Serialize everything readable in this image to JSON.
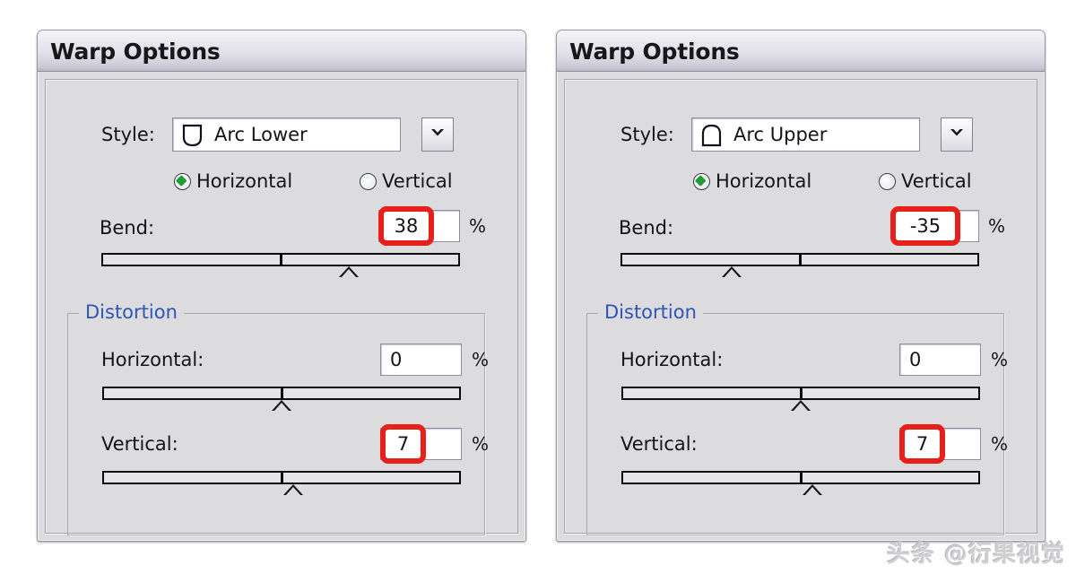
{
  "watermark": "头条 @衍果视觉",
  "panels": [
    {
      "title": "Warp Options",
      "style": {
        "label": "Style:",
        "value": "Arc Lower",
        "icon": "arc-lower-shape-icon",
        "dropdown_icon": "chevron-down-icon"
      },
      "orientation": {
        "horizontal": {
          "label": "Horizontal",
          "selected": true
        },
        "vertical": {
          "label": "Vertical",
          "selected": false
        }
      },
      "bend": {
        "label": "Bend:",
        "value": "38",
        "unit": "%",
        "highlighted": true,
        "thumb_pct": 69
      },
      "distortion": {
        "title": "Distortion",
        "horizontal": {
          "label": "Horizontal:",
          "value": "0",
          "unit": "%",
          "highlighted": false,
          "thumb_pct": 50
        },
        "vertical": {
          "label": "Vertical:",
          "value": "7",
          "unit": "%",
          "highlighted": true,
          "thumb_pct": 53
        }
      }
    },
    {
      "title": "Warp Options",
      "style": {
        "label": "Style:",
        "value": "Arc Upper",
        "icon": "arc-upper-shape-icon",
        "dropdown_icon": "chevron-down-icon"
      },
      "orientation": {
        "horizontal": {
          "label": "Horizontal",
          "selected": true
        },
        "vertical": {
          "label": "Vertical",
          "selected": false
        }
      },
      "bend": {
        "label": "Bend:",
        "value": "-35",
        "unit": "%",
        "highlighted": true,
        "thumb_pct": 31
      },
      "distortion": {
        "title": "Distortion",
        "horizontal": {
          "label": "Horizontal:",
          "value": "0",
          "unit": "%",
          "highlighted": false,
          "thumb_pct": 50
        },
        "vertical": {
          "label": "Vertical:",
          "value": "7",
          "unit": "%",
          "highlighted": true,
          "thumb_pct": 53
        }
      }
    }
  ],
  "colors": {
    "highlight": "#e8201c",
    "group_title": "#2e56b4",
    "radio_dot": "#1f9e34",
    "dialog_bg": "#dcdcdf"
  }
}
